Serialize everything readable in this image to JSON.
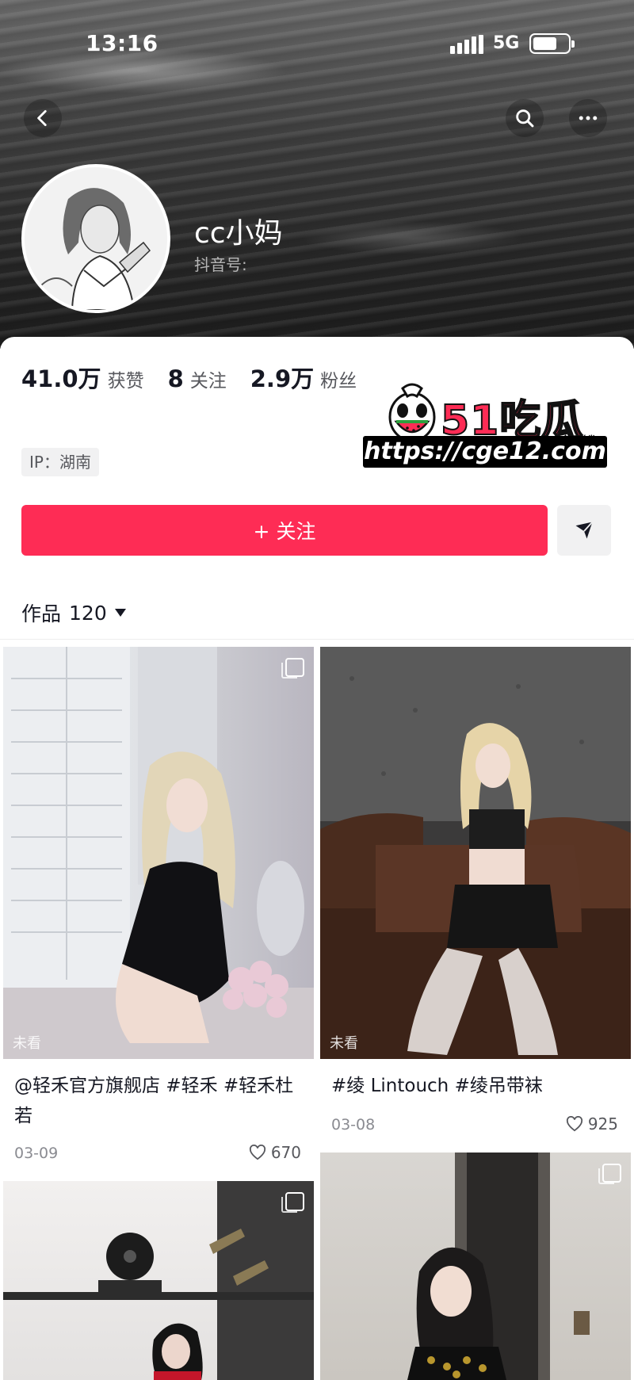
{
  "status_bar": {
    "time": "13:16",
    "network": "5G",
    "battery_level": 0.7
  },
  "nav": {
    "back_icon": "chevron-left-icon",
    "search_icon": "search-icon",
    "more_icon": "more-horizontal-icon"
  },
  "profile": {
    "name": "cc小妈",
    "id_label": "抖音号:",
    "stats": [
      {
        "value": "41.0万",
        "label": "获赞"
      },
      {
        "value": "8",
        "label": "关注"
      },
      {
        "value": "2.9万",
        "label": "粉丝"
      }
    ],
    "ip": "IP：湖南",
    "follow_label": "+ 关注",
    "dm_icon": "send-icon"
  },
  "works": {
    "label": "作品",
    "count": "120"
  },
  "watermark": {
    "brand": "51吃瓜",
    "sub": "全网首发",
    "url": "https://cge12.com"
  },
  "posts": [
    {
      "caption": "@轻禾官方旗舰店 #轻禾 #轻禾杜若",
      "date": "03-09",
      "likes": "670",
      "badge": "未看"
    },
    {
      "caption": "#绫 Lintouch #绫吊带袜",
      "date": "03-08",
      "likes": "925",
      "badge": "未看"
    },
    {
      "caption": "",
      "date": "",
      "likes": "",
      "badge": ""
    },
    {
      "caption": "",
      "date": "",
      "likes": "",
      "badge": ""
    }
  ],
  "colors": {
    "accent": "#fe2c55",
    "text": "#161823",
    "secondary": "#57585d"
  }
}
